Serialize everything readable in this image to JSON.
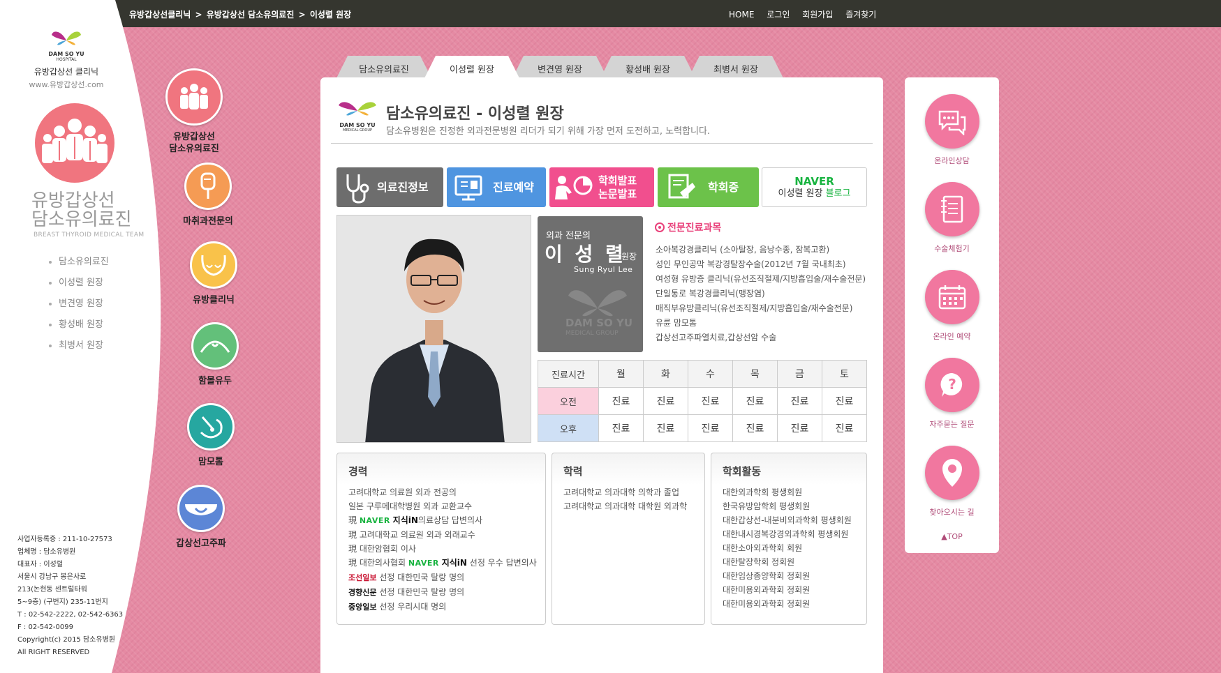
{
  "breadcrumb": [
    "유방갑상선클리닉",
    "유방갑상선 담소유의료진",
    "이성렬 원장"
  ],
  "topnav": [
    "HOME",
    "로그인",
    "회원가입",
    "즐겨찾기"
  ],
  "logo": {
    "brand1": "DAM SO YU",
    "brand2": "HOSPITAL",
    "clinic": "유방갑상선 클리닉",
    "url": "www.유방갑상선.com"
  },
  "team": {
    "title1": "유방갑상선",
    "title2": "담소유의료진",
    "subtitle": "BREAST THYROID MEDICAL TEAM"
  },
  "leftmenu": [
    "담소유의료진",
    "이성렬 원장",
    "변견영 원장",
    "황성배 원장",
    "최병서 원장"
  ],
  "company": [
    "사업자등록증 : 211-10-27573",
    "업체명 : 담소유병원",
    "대표자 : 이성렬",
    "서울시 강남구 봉은사로",
    "213(논현동 센트럴타워",
    "5~9층) (구번지) 235-11번지",
    "T : 02-542-2222, 02-542-6363",
    "F : 02-542-0099",
    "Copyright(c) 2015 담소유병원",
    "All RIGHT RESERVED"
  ],
  "categories": {
    "team": [
      "유방갑상선",
      "담소유의료진"
    ],
    "anesthesia": "마취과전문의",
    "breast": "유방클리닉",
    "nipple": "함몰유두",
    "mammotome": "맘모톰",
    "thyroid": "갑상선고주파"
  },
  "tabs": [
    "담소유의료진",
    "이성렬 원장",
    "변견영 원장",
    "황성배 원장",
    "최병서 원장"
  ],
  "header": {
    "logo_text1": "DAM SO YU",
    "logo_text2": "MEDICAL GROUP",
    "title": "담소유의료진 - 이성렬 원장",
    "desc": "담소유병원은 진정한 외과전문병원 리더가 되기 위해 가장 먼저 도전하고, 노력합니다."
  },
  "buttons": {
    "info": "의료진정보",
    "reserve": "진료예약",
    "paper1": "학회발표",
    "paper2": "논문발표",
    "cert": "학회증",
    "blog_naver": "NAVER",
    "blog_name": "이성렬 원장",
    "blog_word": "블로그"
  },
  "namecard": {
    "specialty": "외과 전문의",
    "name": "이 성 렬",
    "position": "원장",
    "eng": "Sung Ryul Lee",
    "wm1": "DAM SO YU",
    "wm2": "MEDICAL GROUP"
  },
  "specialty": {
    "title": "전문진료과목",
    "items": [
      "소아복강경클리닉 (소아탈장, 음낭수종, 잠복고환)",
      "성인 무인공막 복강경탈장수술(2012년 7월 국내최초)",
      "여성형 유방증 클리닉(유선조직절제/지방흡입술/재수술전문)",
      "단일통로 복강경클리닉(맹장염)",
      "매직부유방클리닉(유선조직절제/지방흡입술/재수술전문)",
      "유륜 맘모톰",
      "갑상선고주파열치료,갑상선암 수술"
    ]
  },
  "schedule": {
    "head": [
      "진료시간",
      "월",
      "화",
      "수",
      "목",
      "금",
      "토"
    ],
    "am_label": "오전",
    "am": [
      "진료",
      "진료",
      "진료",
      "진료",
      "진료",
      "진료"
    ],
    "pm_label": "오후",
    "pm": [
      "진료",
      "진료",
      "진료",
      "진료",
      "진료",
      "진료"
    ]
  },
  "career": {
    "title": "경력",
    "l1": "고려대학교 의료원 외과 전공의",
    "l2": "일본 구루메대학병원 외과 교환교수",
    "l3_pre": "現",
    "l3_naver": "NAVER",
    "l3_jisik": "지식iN",
    "l3_post": "의료상담 답변의사",
    "l4": "現 고려대학교 의료원 외과 외래교수",
    "l5": "現 대한암협회 이사",
    "l6_pre": "現 대한의사협회",
    "l6_naver": "NAVER",
    "l6_jisik": "지식iN",
    "l6_post": "선정 우수 답변의사",
    "l7_logo": "조선일보",
    "l7": "선정 대한민국 탈랑 명의",
    "l8_logo": "경향신문",
    "l8": "선정 대한민국 탈랑 명의",
    "l9_logo": "중앙일보",
    "l9": "선정 우리시대 명의"
  },
  "education": {
    "title": "학력",
    "items": [
      "고려대학교 의과대학 의학과 졸업",
      "고려대학교 의과대학 대학원 외과학"
    ]
  },
  "society": {
    "title": "학회활동",
    "items": [
      "대한외과학회 평생회원",
      "한국유방암학회 평생회원",
      "대한갑상선-내분비외과학회 평생회원",
      "대한내시경복강경외과학회 평생회원",
      "대한소아외과학회 회원",
      "대한탈장학회 정회원",
      "대한임상종양학회 정회원",
      "대한미용외과학회 정회원",
      "대한미용외과학회 정회원"
    ]
  },
  "quick": [
    "온라인상담",
    "수술체험기",
    "온라인 예약",
    "자주묻는 질문",
    "찾아오시는 길"
  ],
  "top_label": "▲TOP",
  "colors": {
    "pink_bg": "#e58aa3",
    "accent": "#e9407a",
    "topbar": "#35362f",
    "btn_gray": "#6d6d6d",
    "btn_blue": "#4f95e0",
    "btn_pink": "#f14f8e",
    "btn_green": "#6cc24a",
    "naver_green": "#17b33f"
  }
}
